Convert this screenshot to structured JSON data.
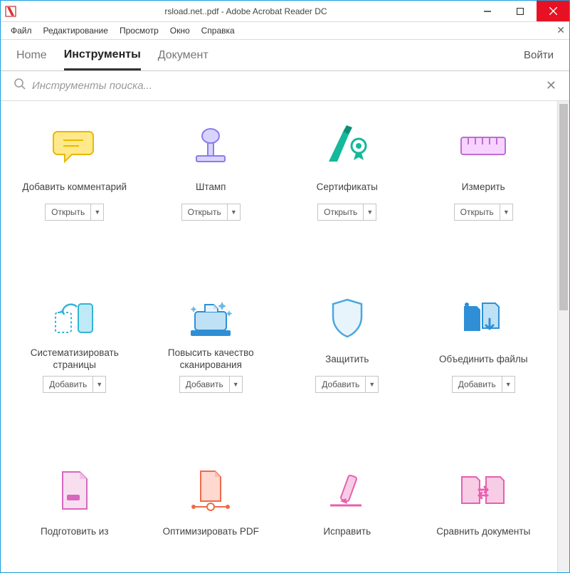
{
  "window": {
    "title": "rsload.net..pdf - Adobe Acrobat Reader DC"
  },
  "menubar": {
    "items": [
      "Файл",
      "Редактирование",
      "Просмотр",
      "Окно",
      "Справка"
    ]
  },
  "tabs": {
    "home": "Home",
    "tools": "Инструменты",
    "document": "Документ",
    "signin": "Войти"
  },
  "search": {
    "placeholder": "Инструменты поиска..."
  },
  "actions": {
    "open": "Открыть",
    "add": "Добавить"
  },
  "tools": [
    {
      "label": "Добавить комментарий",
      "action": "open"
    },
    {
      "label": "Штамп",
      "action": "open"
    },
    {
      "label": "Сертификаты",
      "action": "open"
    },
    {
      "label": "Измерить",
      "action": "open"
    },
    {
      "label": "Систематизировать страницы",
      "action": "add"
    },
    {
      "label": "Повысить качество сканирования",
      "action": "add"
    },
    {
      "label": "Защитить",
      "action": "add"
    },
    {
      "label": "Объединить файлы",
      "action": "add"
    },
    {
      "label": "Подготовить из",
      "action": "add"
    },
    {
      "label": "Оптимизировать PDF",
      "action": "add"
    },
    {
      "label": "Исправить",
      "action": "add"
    },
    {
      "label": "Сравнить документы",
      "action": "add"
    }
  ]
}
